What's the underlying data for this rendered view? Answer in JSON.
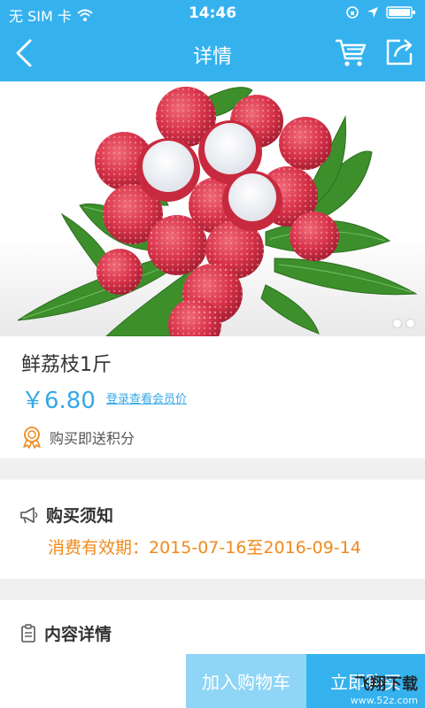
{
  "status_bar": {
    "carrier": "无 SIM 卡",
    "time": "14:46"
  },
  "nav": {
    "title": "详情"
  },
  "product": {
    "name": "鲜荔枝1斤",
    "price": "￥6.80",
    "member_price_link": "登录查看会员价",
    "points_text": "购买即送积分"
  },
  "carousel": {
    "page_count": 2
  },
  "purchase_notice": {
    "heading": "购买须知",
    "validity": "消费有效期：2015-07-16至2016-09-14"
  },
  "details": {
    "heading": "内容详情"
  },
  "actions": {
    "add_to_cart": "加入购物车",
    "buy_now": "立即购买"
  },
  "watermark": {
    "brand": "飞翔下载",
    "url": "www.52z.com"
  },
  "colors": {
    "brand_blue": "#35b2ee",
    "orange": "#f08a1c"
  }
}
